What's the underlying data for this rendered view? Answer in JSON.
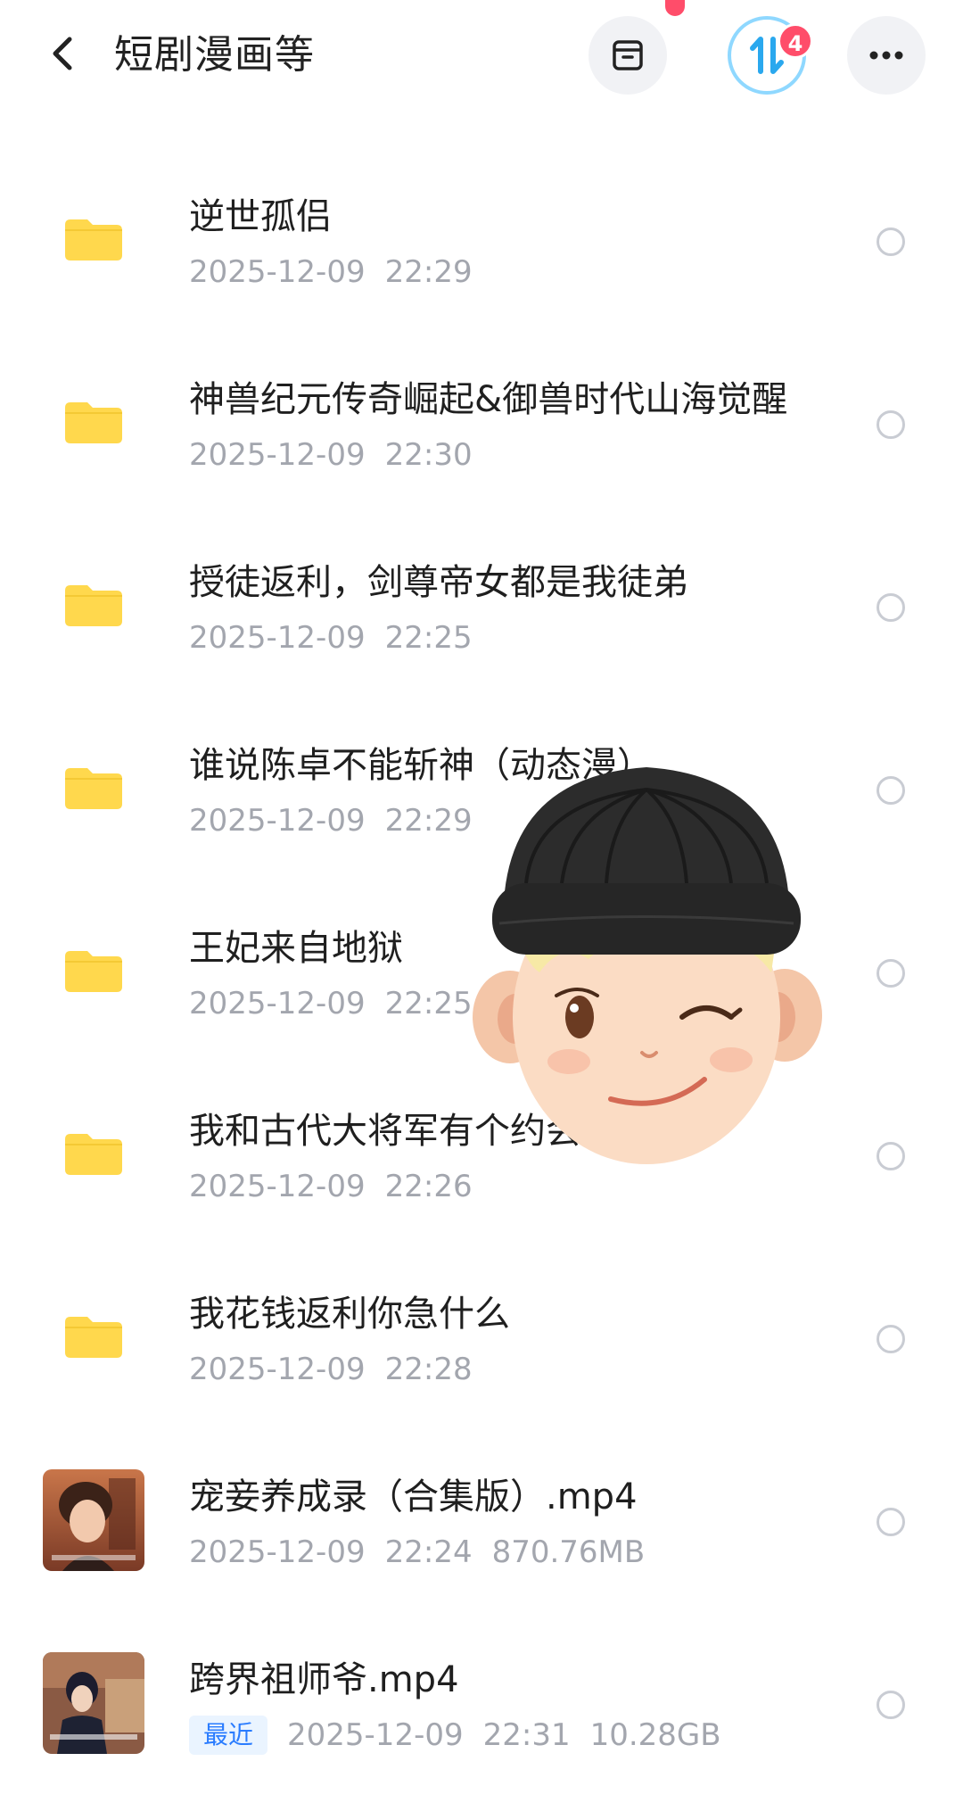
{
  "header": {
    "title": "短剧漫画等",
    "transfer_badge": "4"
  },
  "files": [
    {
      "type": "folder",
      "name": "逆世孤侣",
      "date": "2025-12-09",
      "time": "22:29"
    },
    {
      "type": "folder",
      "name": "神兽纪元传奇崛起&御兽时代山海觉醒",
      "date": "2025-12-09",
      "time": "22:30"
    },
    {
      "type": "folder",
      "name": "授徒返利，剑尊帝女都是我徒弟",
      "date": "2025-12-09",
      "time": "22:25"
    },
    {
      "type": "folder",
      "name": "谁说陈卓不能斩神（动态漫）",
      "date": "2025-12-09",
      "time": "22:29"
    },
    {
      "type": "folder",
      "name": "王妃来自地狱",
      "date": "2025-12-09",
      "time": "22:25"
    },
    {
      "type": "folder",
      "name": "我和古代大将军有个约会",
      "date": "2025-12-09",
      "time": "22:26"
    },
    {
      "type": "folder",
      "name": "我花钱返利你急什么",
      "date": "2025-12-09",
      "time": "22:28"
    },
    {
      "type": "video",
      "name": "宠妾养成录（合集版）.mp4",
      "date": "2025-12-09",
      "time": "22:24",
      "size": "870.76MB"
    },
    {
      "type": "video",
      "name": "跨界祖师爷.mp4",
      "tag": "最近",
      "date": "2025-12-09",
      "time": "22:31",
      "size": "10.28GB"
    }
  ],
  "icons": {
    "back": "chevron-left-icon",
    "archive": "archive-box-icon",
    "transfer": "transfer-arrows-icon",
    "more": "more-dots-icon",
    "folder": "folder-icon"
  },
  "colors": {
    "folder": "#ffd84d",
    "badge": "#ff4d6a",
    "meta_text": "#a3a6ae",
    "recent_tag": "#2a7cff"
  }
}
